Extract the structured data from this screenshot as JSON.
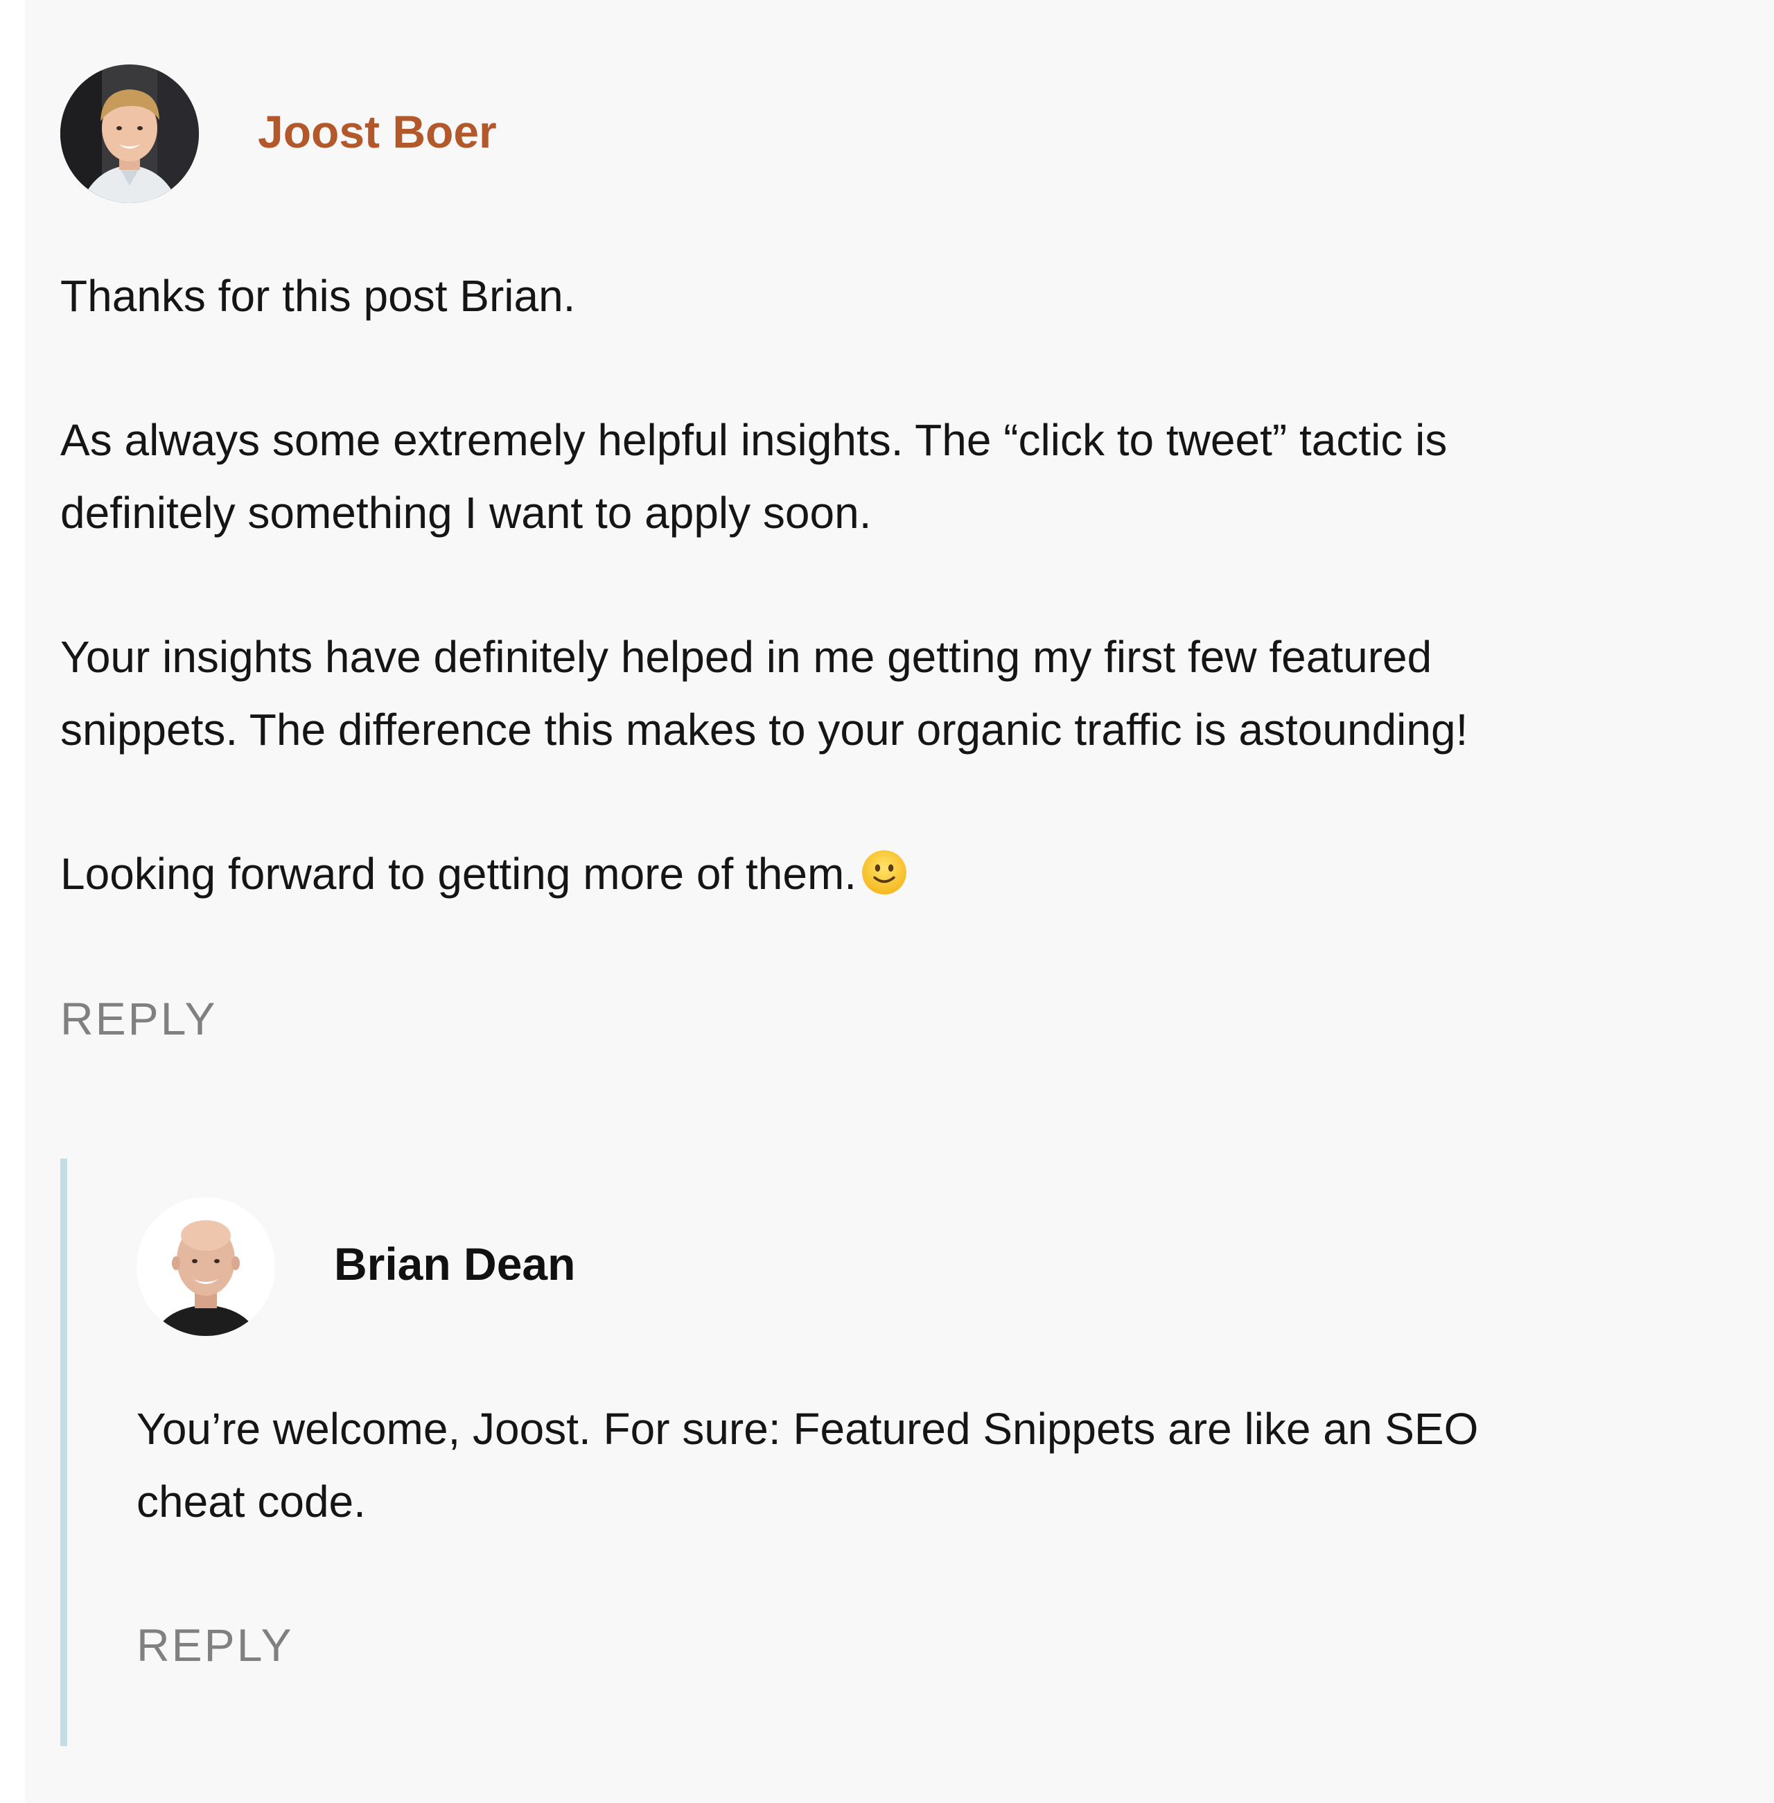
{
  "comments": [
    {
      "author": "Joost Boer",
      "paragraphs": [
        "Thanks for this post Brian.",
        "As always some extremely helpful insights. The “click to tweet” tactic is",
        "definitely something I want to apply soon.",
        "Your insights have definitely helped in me getting my first few featured",
        "snippets. The difference this makes to your organic traffic is astounding!",
        "Looking forward to getting more of them."
      ],
      "emoji": "slightly-smiling-face",
      "reply_label": "REPLY"
    },
    {
      "author": "Brian Dean",
      "paragraphs": [
        "You’re welcome, Joost. For sure: Featured Snippets are like an SEO",
        "cheat code."
      ],
      "reply_label": "REPLY"
    }
  ],
  "colors": {
    "card_background": "#f8f8f8",
    "author_link": "#b2582b",
    "reply_text": "#808080",
    "thread_line": "#c4dde4"
  }
}
